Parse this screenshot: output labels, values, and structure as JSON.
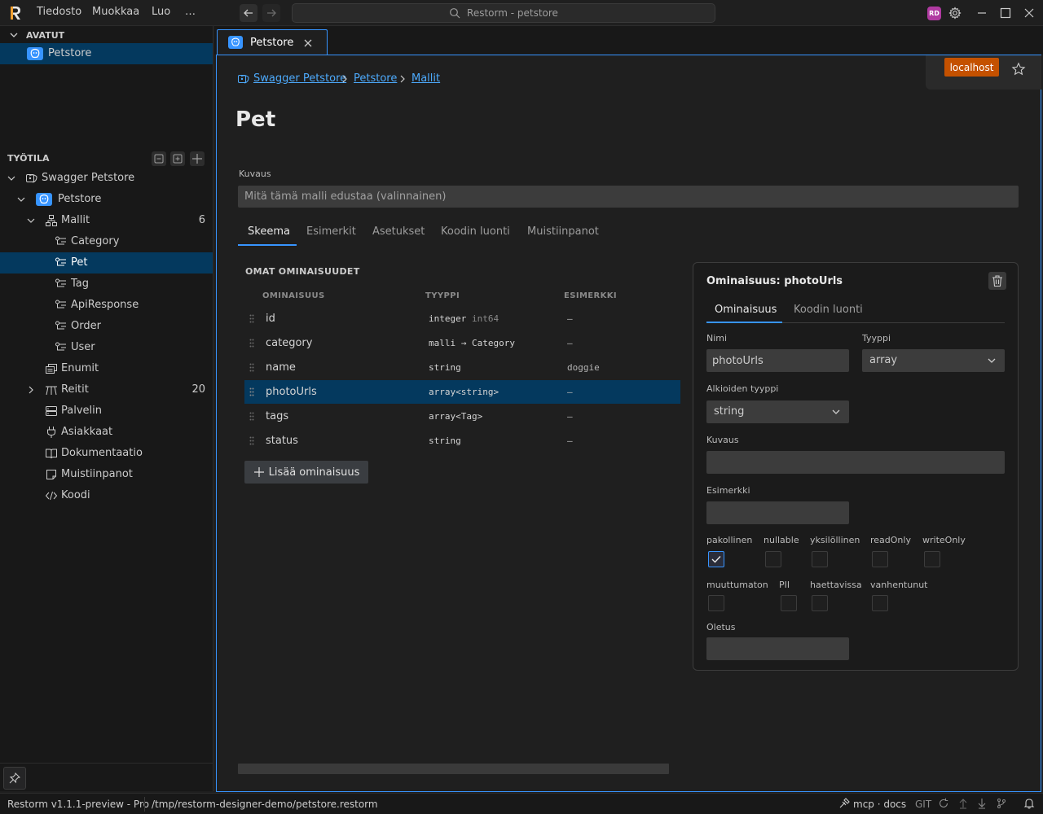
{
  "window": {
    "search_title": "Restorm - petstore",
    "menus": [
      "Tiedosto",
      "Muokkaa",
      "Luo",
      "…"
    ],
    "user_badge": "RD"
  },
  "sidebar": {
    "open_header": "AVATUT",
    "open_items": [
      {
        "label": "Petstore",
        "icon": "petstore-icon"
      }
    ],
    "workspace_header": "TYÖTILA",
    "tree": [
      {
        "label": "Swagger Petstore",
        "icon": "swagger-icon"
      },
      {
        "label": "Petstore",
        "icon": "petstore-icon"
      },
      {
        "label": "Mallit",
        "icon": "models-icon",
        "count": "6"
      },
      {
        "label": "Category",
        "icon": "model-icon"
      },
      {
        "label": "Pet",
        "icon": "model-icon",
        "selected": true
      },
      {
        "label": "Tag",
        "icon": "model-icon"
      },
      {
        "label": "ApiResponse",
        "icon": "model-icon"
      },
      {
        "label": "Order",
        "icon": "model-icon"
      },
      {
        "label": "User",
        "icon": "model-icon"
      },
      {
        "label": "Enumit",
        "icon": "enum-icon"
      },
      {
        "label": "Reitit",
        "icon": "routes-icon",
        "count": "20"
      },
      {
        "label": "Palvelin",
        "icon": "server-icon"
      },
      {
        "label": "Asiakkaat",
        "icon": "plug-icon"
      },
      {
        "label": "Dokumentaatio",
        "icon": "book-icon"
      },
      {
        "label": "Muistiinpanot",
        "icon": "note-icon"
      },
      {
        "label": "Koodi",
        "icon": "code-icon"
      }
    ]
  },
  "tabs": [
    {
      "label": "Petstore",
      "icon": "petstore-icon"
    }
  ],
  "server": {
    "label": "localhost"
  },
  "breadcrumb": [
    "Swagger Petstore",
    "Petstore",
    "Mallit"
  ],
  "page": {
    "title": "Pet",
    "description_label": "Kuvaus",
    "description_placeholder": "Mitä tämä malli edustaa (valinnainen)"
  },
  "editor_tabs": [
    "Skeema",
    "Esimerkit",
    "Asetukset",
    "Koodin luonti",
    "Muistiinpanot"
  ],
  "properties": {
    "section_title": "OMAT OMINAISUUDET",
    "columns": [
      "OMINAISUUS",
      "TYYPPI",
      "ESIMERKKI"
    ],
    "rows": [
      {
        "name": "id",
        "type": "integer",
        "format": "int64",
        "example": "–"
      },
      {
        "name": "category",
        "type": "malli → Category",
        "format": "",
        "example": "–"
      },
      {
        "name": "name",
        "type": "string",
        "format": "",
        "example": "doggie"
      },
      {
        "name": "photoUrls",
        "type": "array<string>",
        "format": "",
        "example": "–",
        "selected": true
      },
      {
        "name": "tags",
        "type": "array<Tag>",
        "format": "",
        "example": "–"
      },
      {
        "name": "status",
        "type": "string",
        "format": "",
        "example": "–"
      }
    ],
    "add_label": "Lisää ominaisuus"
  },
  "detail": {
    "title": "Ominaisuus: photoUrls",
    "tabs": [
      "Ominaisuus",
      "Koodin luonti"
    ],
    "name_label": "Nimi",
    "name_value": "photoUrls",
    "type_label": "Tyyppi",
    "type_value": "array",
    "item_type_label": "Alkioiden tyyppi",
    "item_type_value": "string",
    "description_label": "Kuvaus",
    "description_value": "",
    "example_label": "Esimerkki",
    "example_value": "",
    "flags_row1": [
      {
        "label": "pakollinen",
        "checked": true
      },
      {
        "label": "nullable",
        "checked": false
      },
      {
        "label": "yksilöllinen",
        "checked": false
      },
      {
        "label": "readOnly",
        "checked": false
      },
      {
        "label": "writeOnly",
        "checked": false
      }
    ],
    "flags_row2": [
      {
        "label": "muuttumaton",
        "checked": false
      },
      {
        "label": "PII",
        "checked": false
      },
      {
        "label": "haettavissa",
        "checked": false
      },
      {
        "label": "vanhentunut",
        "checked": false
      }
    ],
    "default_label": "Oletus",
    "default_value": ""
  },
  "statusbar": {
    "version": "Restorm v1.1.1-preview - Pro",
    "path": "/tmp/restorm-designer-demo/petstore.restorm",
    "mcp": "mcp · docs",
    "git": "GIT"
  },
  "colors": {
    "accent": "#3794ff",
    "selection": "#04395e",
    "server_badge": "#c45100",
    "user_badge": "#b03aa1"
  }
}
